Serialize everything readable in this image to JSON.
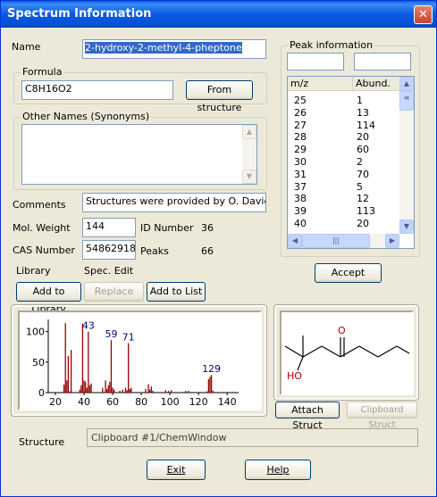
{
  "window": {
    "title": "Spectrum Information",
    "close_glyph": "✕"
  },
  "name": {
    "label": "Name",
    "value": "2-hydroxy-2-methyl-4-pheptone"
  },
  "formula": {
    "group_label": "Formula",
    "value": "C8H16O2",
    "from_structure_label": "From structure"
  },
  "other_names": {
    "group_label": "Other Names (Synonyms)",
    "value": ""
  },
  "comments": {
    "label": "Comments",
    "value": "Structures were provided by O. David Spa"
  },
  "mol_weight": {
    "label": "Mol. Weight",
    "value": "144"
  },
  "id_number": {
    "label": "ID Number",
    "value": "36"
  },
  "cas_number": {
    "label": "CAS Number",
    "value": "54862918"
  },
  "peaks": {
    "label": "Peaks",
    "value": "66"
  },
  "library": {
    "label": "Library",
    "spec_edit_label": "Spec. Edit"
  },
  "buttons": {
    "add_to_library": "Add to Library",
    "replace": "Replace",
    "add_to_list": "Add to List",
    "accept": "Accept",
    "attach_struct": "Attach Struct",
    "clipboard_struct": "Clipboard Struct",
    "exit": "Exit",
    "help": "Help"
  },
  "peak_info": {
    "group_label": "Peak information",
    "columns": [
      "m/z",
      "Abund."
    ],
    "rows": [
      [
        "25",
        "1"
      ],
      [
        "26",
        "13"
      ],
      [
        "27",
        "114"
      ],
      [
        "28",
        "20"
      ],
      [
        "29",
        "60"
      ],
      [
        "30",
        "2"
      ],
      [
        "31",
        "70"
      ],
      [
        "37",
        "5"
      ],
      [
        "38",
        "12"
      ],
      [
        "39",
        "113"
      ],
      [
        "40",
        "20"
      ]
    ]
  },
  "structure": {
    "label": "Structure",
    "value": "Clipboard #1/ChemWindow",
    "atom_o": "O",
    "atom_ho": "HO"
  },
  "chart_data": {
    "type": "bar",
    "title": "",
    "xlabel": "",
    "ylabel": "",
    "xlim": [
      15,
      148
    ],
    "ylim": [
      0,
      120
    ],
    "x_ticks": [
      "20",
      "40",
      "60",
      "80",
      "100",
      "120",
      "140"
    ],
    "y_ticks": [
      "0",
      "50",
      "100"
    ],
    "peak_labels": [
      "43",
      "59",
      "71",
      "129"
    ],
    "series": [
      {
        "x": [
          25,
          26,
          27,
          28,
          29,
          30,
          31,
          37,
          38,
          39,
          40,
          41,
          42,
          43,
          44,
          45,
          53,
          55,
          56,
          57,
          58,
          59,
          60,
          61,
          65,
          67,
          69,
          70,
          71,
          72,
          73,
          83,
          85,
          86,
          87,
          88,
          97,
          99,
          101,
          111,
          113,
          126,
          127,
          128,
          129,
          130,
          144
        ],
        "y": [
          1,
          13,
          114,
          20,
          60,
          2,
          70,
          5,
          12,
          113,
          20,
          18,
          8,
          100,
          12,
          15,
          8,
          20,
          6,
          12,
          18,
          86,
          8,
          5,
          3,
          5,
          8,
          4,
          81,
          6,
          8,
          6,
          14,
          5,
          10,
          3,
          4,
          3,
          4,
          3,
          3,
          2,
          22,
          26,
          29,
          3,
          1
        ]
      }
    ],
    "color": "#990000"
  }
}
